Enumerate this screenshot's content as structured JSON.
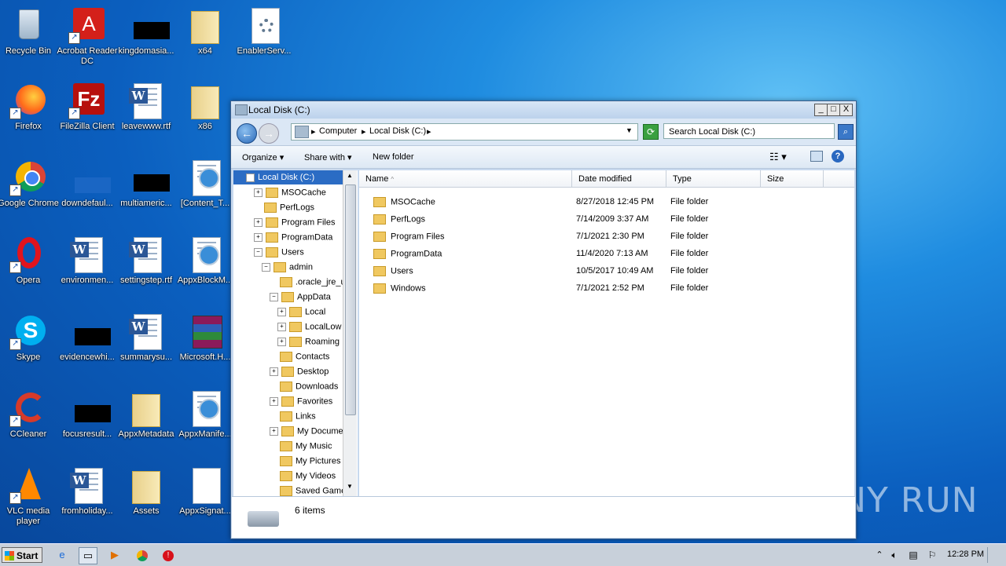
{
  "desktop": {
    "icons": [
      {
        "label": "Recycle Bin"
      },
      {
        "label": "Acrobat Reader DC"
      },
      {
        "label": "kingdomasia..."
      },
      {
        "label": "x64"
      },
      {
        "label": "EnablerServ..."
      },
      {
        "label": "Firefox"
      },
      {
        "label": "FileZilla Client"
      },
      {
        "label": "leavewww.rtf"
      },
      {
        "label": "x86"
      },
      {
        "label": "Google Chrome"
      },
      {
        "label": "downdefaul..."
      },
      {
        "label": "multiameric..."
      },
      {
        "label": "[Content_T..."
      },
      {
        "label": "Opera"
      },
      {
        "label": "environmen..."
      },
      {
        "label": "settingstep.rtf"
      },
      {
        "label": "AppxBlockM..."
      },
      {
        "label": "Skype"
      },
      {
        "label": "evidencewhi..."
      },
      {
        "label": "summarysu..."
      },
      {
        "label": "Microsoft.H..."
      },
      {
        "label": "CCleaner"
      },
      {
        "label": "focusresult..."
      },
      {
        "label": "AppxMetadata"
      },
      {
        "label": "AppxManife..."
      },
      {
        "label": "VLC media player"
      },
      {
        "label": "fromholiday..."
      },
      {
        "label": "Assets"
      },
      {
        "label": "AppxSignat..."
      }
    ],
    "watermark": "ANY RUN"
  },
  "window": {
    "title": "Local Disk (C:)",
    "minimize": "_",
    "maximize": "□",
    "close": "X",
    "breadcrumb": [
      "Computer",
      "Local Disk (C:)"
    ],
    "search_placeholder": "Search Local Disk (C:)",
    "toolbar": {
      "organize": "Organize",
      "share_with": "Share with",
      "new_folder": "New folder"
    },
    "nav_tree": [
      {
        "label": "Local Disk (C:)",
        "exp": "−"
      },
      {
        "label": "MSOCache",
        "exp": "+"
      },
      {
        "label": "PerfLogs",
        "exp": ""
      },
      {
        "label": "Program Files",
        "exp": "+"
      },
      {
        "label": "ProgramData",
        "exp": "+"
      },
      {
        "label": "Users",
        "exp": "−"
      },
      {
        "label": "admin",
        "exp": "−"
      },
      {
        "label": ".oracle_jre_u",
        "exp": ""
      },
      {
        "label": "AppData",
        "exp": "−"
      },
      {
        "label": "Local",
        "exp": "+"
      },
      {
        "label": "LocalLow",
        "exp": "+"
      },
      {
        "label": "Roaming",
        "exp": "+"
      },
      {
        "label": "Contacts",
        "exp": ""
      },
      {
        "label": "Desktop",
        "exp": "+"
      },
      {
        "label": "Downloads",
        "exp": ""
      },
      {
        "label": "Favorites",
        "exp": "+"
      },
      {
        "label": "Links",
        "exp": ""
      },
      {
        "label": "My Documen",
        "exp": "+"
      },
      {
        "label": "My Music",
        "exp": ""
      },
      {
        "label": "My Pictures",
        "exp": ""
      },
      {
        "label": "My Videos",
        "exp": ""
      },
      {
        "label": "Saved Game",
        "exp": ""
      }
    ],
    "columns": {
      "name": "Name",
      "date": "Date modified",
      "type": "Type",
      "size": "Size"
    },
    "files": [
      {
        "name": "MSOCache",
        "date": "8/27/2018 12:45 PM",
        "type": "File folder"
      },
      {
        "name": "PerfLogs",
        "date": "7/14/2009 3:37 AM",
        "type": "File folder"
      },
      {
        "name": "Program Files",
        "date": "7/1/2021 2:30 PM",
        "type": "File folder"
      },
      {
        "name": "ProgramData",
        "date": "11/4/2020 7:13 AM",
        "type": "File folder"
      },
      {
        "name": "Users",
        "date": "10/5/2017 10:49 AM",
        "type": "File folder"
      },
      {
        "name": "Windows",
        "date": "7/1/2021 2:52 PM",
        "type": "File folder"
      }
    ],
    "status_count": "6 items"
  },
  "taskbar": {
    "start": "Start",
    "clock": "12:28 PM"
  }
}
